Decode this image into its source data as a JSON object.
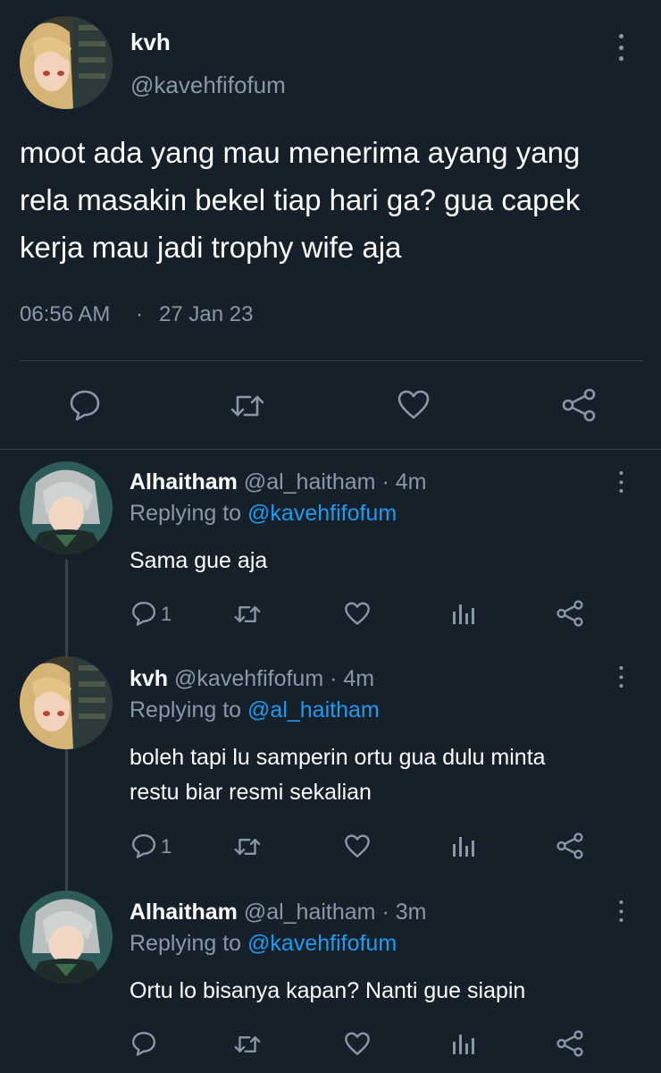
{
  "main_tweet": {
    "display_name": "kvh",
    "handle": "@kavehfifofum",
    "text_lines": [
      "moot ada yang mau menerima ayang yang",
      "rela masakin bekel tiap hari ga? gua capek",
      "kerja mau jadi trophy wife aja"
    ],
    "time": "06:56 AM",
    "dot": "·",
    "date": "27 Jan 23"
  },
  "replies": [
    {
      "display_name": "Alhaitham",
      "handle": "@al_haitham",
      "meta": "· 4m",
      "replying_prefix": "Replying to",
      "replying_to": "@kavehfifofum",
      "text_lines": [
        "Sama gue aja"
      ],
      "reply_count": "1"
    },
    {
      "display_name": "kvh",
      "handle": "@kavehfifofum",
      "meta": "· 4m",
      "replying_prefix": "Replying to",
      "replying_to": "@al_haitham",
      "text_lines": [
        "boleh tapi lu samperin ortu gua dulu minta",
        "restu biar resmi sekalian"
      ],
      "reply_count": "1"
    },
    {
      "display_name": "Alhaitham",
      "handle": "@al_haitham",
      "meta": "· 3m",
      "replying_prefix": "Replying to",
      "replying_to": "@kavehfifofum",
      "text_lines": [
        "Ortu lo bisanya kapan? Nanti gue siapin"
      ],
      "reply_count": ""
    }
  ],
  "icons": {
    "reply": "comment-icon",
    "retweet": "retweet-icon",
    "like": "heart-icon",
    "analytics": "bar-chart-icon",
    "share": "share-icon",
    "more": "more-vertical-icon"
  },
  "colors": {
    "background": "#15202b",
    "text": "#ffffff",
    "muted": "#8899a6",
    "link": "#1d9bf0",
    "divider": "#38444d"
  }
}
